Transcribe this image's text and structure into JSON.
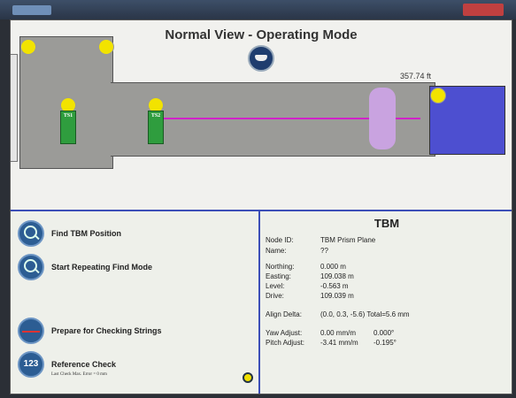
{
  "title_bar": {
    "app_name": ""
  },
  "view": {
    "title": "Normal View - Operating Mode",
    "distance_label": "357.74 ft",
    "stations": [
      "TS1",
      "TS2"
    ]
  },
  "actions": [
    {
      "label": "Find TBM Position",
      "icon": "magnifier-icon"
    },
    {
      "label": "Start Repeating Find Mode",
      "icon": "magnifier-icon"
    },
    {
      "label": "Prepare for Checking Strings",
      "icon": "check-strings-icon"
    },
    {
      "label": "Reference Check",
      "icon": "reference-check-icon",
      "icon_text": "123",
      "sub": "Last Check Max. Error = 0 mm"
    }
  ],
  "tbm": {
    "title": "TBM",
    "node_id_label": "Node ID:",
    "node_id": "TBM Prism Plane",
    "name_label": "Name:",
    "name": "??",
    "northing_label": "Northing:",
    "northing": "0.000 m",
    "easting_label": "Easting:",
    "easting": "109.038 m",
    "level_label": "Level:",
    "level": "-0.563 m",
    "drive_label": "Drive:",
    "drive": "109.039 m",
    "align_label": "Align Delta:",
    "align": "(0.0, 0.3, -5.6)  Total=5.6 mm",
    "yaw_label": "Yaw Adjust:",
    "yaw": "0.00 mm/m",
    "yaw_deg": "0.000°",
    "pitch_label": "Pitch Adjust:",
    "pitch": "-3.41 mm/m",
    "pitch_deg": "-0.195°"
  }
}
